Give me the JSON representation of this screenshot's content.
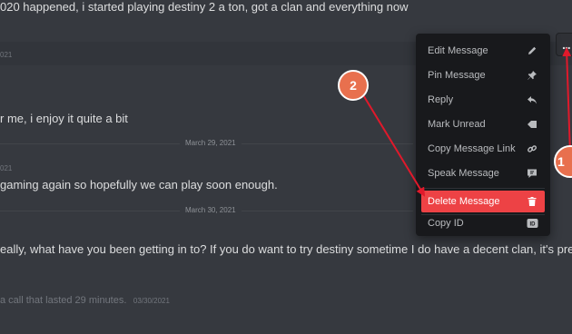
{
  "messages": [
    {
      "text": "020 happened, i started playing destiny 2 a ton, got a clan and everything now"
    },
    {
      "ts": "021"
    },
    {
      "text": "r me, i enjoy it quite a bit"
    },
    {
      "ts": "021"
    },
    {
      "text": "gaming again so hopefully we can play soon enough."
    },
    {
      "text": "eally, what have you been getting in to? If you do want to try destiny sometime I do have a decent clan, it's pretty"
    },
    {
      "text": "a call that lasted 29 minutes.",
      "ts": "03/30/2021"
    }
  ],
  "dividers": [
    {
      "label": "March 29, 2021"
    },
    {
      "label": "March 30, 2021"
    }
  ],
  "context_menu": {
    "items": [
      {
        "label": "Edit Message",
        "icon": "pencil-icon"
      },
      {
        "label": "Pin Message",
        "icon": "pin-icon"
      },
      {
        "label": "Reply",
        "icon": "reply-icon"
      },
      {
        "label": "Mark Unread",
        "icon": "mark-unread-icon"
      },
      {
        "label": "Copy Message Link",
        "icon": "link-icon"
      },
      {
        "label": "Speak Message",
        "icon": "speak-icon"
      },
      {
        "label": "Delete Message",
        "icon": "trash-icon",
        "danger": true
      },
      {
        "label": "Copy ID",
        "icon": "id-icon"
      }
    ]
  },
  "toolbar": {
    "more_label": "..."
  },
  "annotations": {
    "badge_1": "1",
    "badge_2": "2",
    "color": "#e8704e",
    "arrow_color": "#e0192b"
  },
  "colors": {
    "background": "#36393f",
    "menu_bg": "#18191c",
    "danger": "#ed4245"
  }
}
